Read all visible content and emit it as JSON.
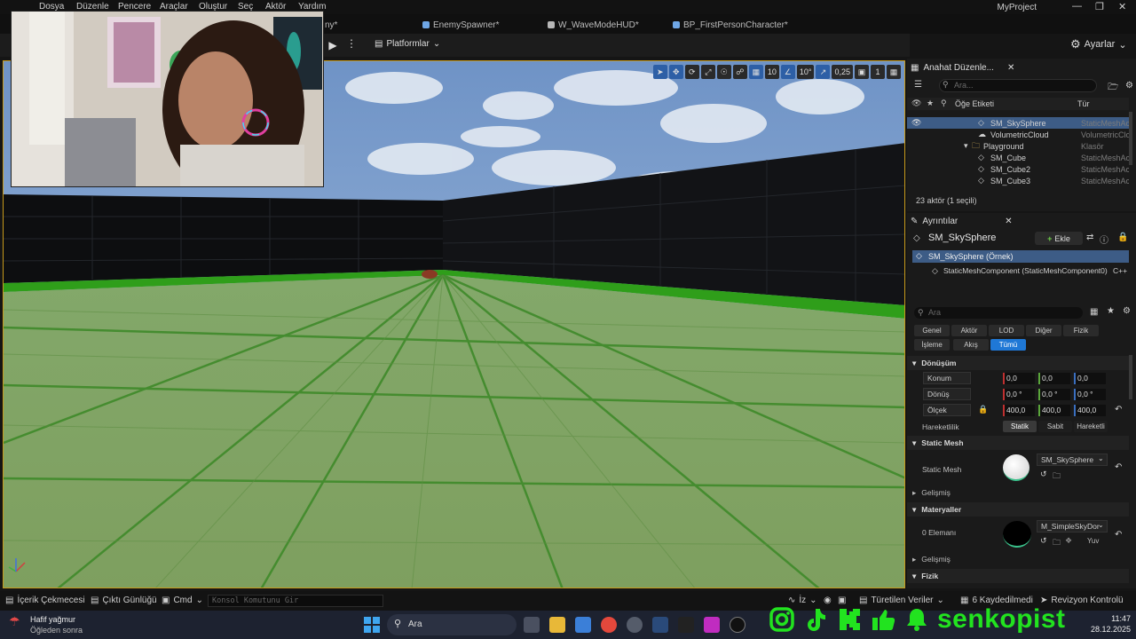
{
  "menu": [
    "Dosya",
    "Düzenle",
    "Pencere",
    "Araçlar",
    "Oluştur",
    "Seç",
    "Aktör",
    "Yardım"
  ],
  "project_name": "MyProject",
  "tabs": [
    {
      "label": "ny*"
    },
    {
      "label": "EnemySpawner*"
    },
    {
      "label": "W_WaveModeHUD*"
    },
    {
      "label": "BP_FirstPersonCharacter*"
    }
  ],
  "toolbar": {
    "platforms_label": "Platformlar",
    "settings_label": "Ayarlar"
  },
  "viewport_tools": {
    "grid_snap": "10",
    "rotation_snap": "10°",
    "scale_snap": "0,25",
    "camera_speed": "1"
  },
  "outliner": {
    "tab_label": "Anahat Düzenle...",
    "search_placeholder": "Ara...",
    "col_label": "Öğe Etiketi",
    "col_type": "Tür",
    "rows": [
      {
        "name": "SM_SkySphere",
        "type": "StaticMeshAc",
        "selected": true
      },
      {
        "name": "VolumetricCloud",
        "type": "VolumetricClo"
      },
      {
        "name": "Playground",
        "type": "Klasör"
      },
      {
        "name": "SM_Cube",
        "type": "StaticMeshAc"
      },
      {
        "name": "SM_Cube2",
        "type": "StaticMeshAc"
      },
      {
        "name": "SM_Cube3",
        "type": "StaticMeshAc"
      }
    ],
    "footer": "23 aktör (1 seçili)"
  },
  "details": {
    "tab_label": "Ayrıntılar",
    "actor_name": "SM_SkySphere",
    "add_label": "Ekle",
    "instance_label": "SM_SkySphere (Örnek)",
    "component_label": "StaticMeshComponent (StaticMeshComponent0)",
    "component_tag": "C++",
    "search_placeholder": "Ara",
    "filters": [
      "Genel",
      "Aktör",
      "LOD",
      "Diğer",
      "Fizik",
      "İşleme",
      "Akış",
      "Tümü"
    ],
    "transform_header": "Dönüşüm",
    "location_label": "Konum",
    "location": [
      "0,0",
      "0,0",
      "0,0"
    ],
    "rotation_label": "Dönüş",
    "rotation": [
      "0,0 °",
      "0,0 °",
      "0,0 °"
    ],
    "scale_label": "Ölçek",
    "scale": [
      "400,0",
      "400,0",
      "400,0"
    ],
    "mobility_label": "Hareketlilik",
    "mobility_options": [
      "Statik",
      "Sabit",
      "Hareketli"
    ],
    "static_mesh_header": "Static Mesh",
    "static_mesh_label": "Static Mesh",
    "static_mesh_value": "SM_SkySphere",
    "advanced_label": "Gelişmiş",
    "materials_header": "Materyaller",
    "element_label": "0 Elemanı",
    "material_value": "M_SimpleSkyDor",
    "material_extra": "Yuv",
    "advanced2_label": "Gelişmiş",
    "physics_header": "Fizik"
  },
  "statusbar": {
    "content_drawer": "İçerik Çekmecesi",
    "output_log": "Çıktı Günlüğü",
    "cmd": "Cmd",
    "console_placeholder": "Konsol Komutunu Gir",
    "trace": "İz",
    "derived_data": "Türetilen Veriler",
    "unsaved": "6 Kaydedilmedi",
    "revision": "Revizyon Kontrolü"
  },
  "taskbar": {
    "weather_title": "Hafif yağmur",
    "weather_sub": "Öğleden sonra",
    "search_label": "Ara",
    "time": "11:47",
    "date": "28.12.2025"
  },
  "brand": {
    "name": "senkopist",
    "color": "#22e31f"
  }
}
